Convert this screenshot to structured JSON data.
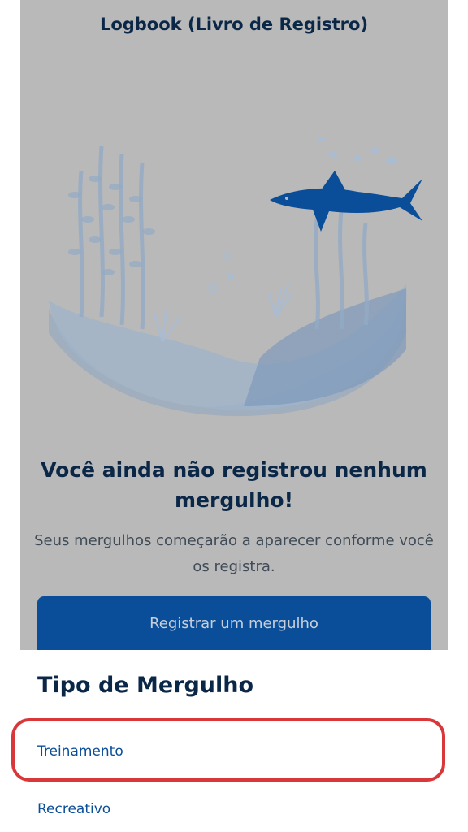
{
  "header": {
    "title": "Logbook (Livro de Registro)"
  },
  "empty_state": {
    "title": "Você ainda não registrou nenhum mergulho!",
    "description": "Seus mergulhos começarão a aparecer conforme você os registra.",
    "cta_label": "Registrar um mergulho",
    "illustration": "underwater-scene-shark-icon"
  },
  "dive_type_sheet": {
    "title": "Tipo de Mergulho",
    "options": [
      {
        "label": "Treinamento",
        "highlighted": true
      },
      {
        "label": "Recreativo",
        "highlighted": false
      }
    ]
  },
  "colors": {
    "overlay": "#b9b9b9",
    "primary": "#0a4e9a",
    "title_text": "#0b2747",
    "highlight": "#d9383a"
  }
}
